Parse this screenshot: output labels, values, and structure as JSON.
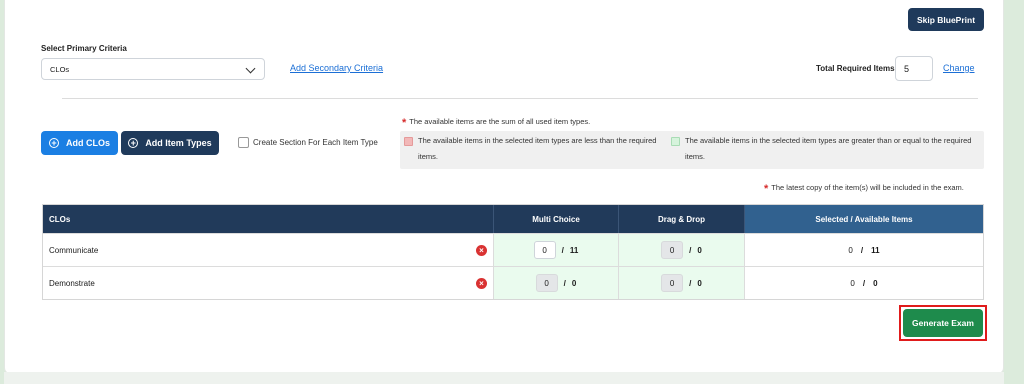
{
  "header": {
    "skip_blueprint_label": "Skip BluePrint"
  },
  "criteria": {
    "primary_label": "Select Primary Criteria",
    "primary_value": "CLOs",
    "add_secondary_label": "Add Secondary Criteria",
    "total_required_label": "Total Required Items:",
    "total_required_value": "5",
    "change_label": "Change"
  },
  "actions": {
    "add_clos_label": "Add CLOs",
    "add_item_types_label": "Add Item Types",
    "create_section_label": "Create Section For Each Item Type"
  },
  "notes": {
    "available_sum": "The available items are the sum of all used item types.",
    "legend_less": "The available items in the selected item types are less than the required items.",
    "legend_greater": "The available items in the selected item types are greater than or equal to the required items.",
    "latest_copy": "The latest copy of the item(s) will be included in the exam."
  },
  "colors": {
    "legend_less": "#f2b8b8",
    "legend_greater": "#d6f3dc",
    "header_dark": "#213a5a",
    "header_accent": "#31618f",
    "generate_button": "#1e8b4c"
  },
  "table": {
    "headers": [
      "CLOs",
      "Multi Choice",
      "Drag & Drop",
      "Selected / Available Items"
    ],
    "rows": [
      {
        "name": "Communicate",
        "mc_value": "0",
        "mc_avail": "11",
        "dd_value": "0",
        "dd_avail": "0",
        "sel_value": "0",
        "sel_avail": "11"
      },
      {
        "name": "Demonstrate",
        "mc_value": "0",
        "mc_avail": "0",
        "dd_value": "0",
        "dd_avail": "0",
        "sel_value": "0",
        "sel_avail": "0"
      }
    ],
    "slash": "/"
  },
  "footer": {
    "generate_label": "Generate Exam"
  }
}
